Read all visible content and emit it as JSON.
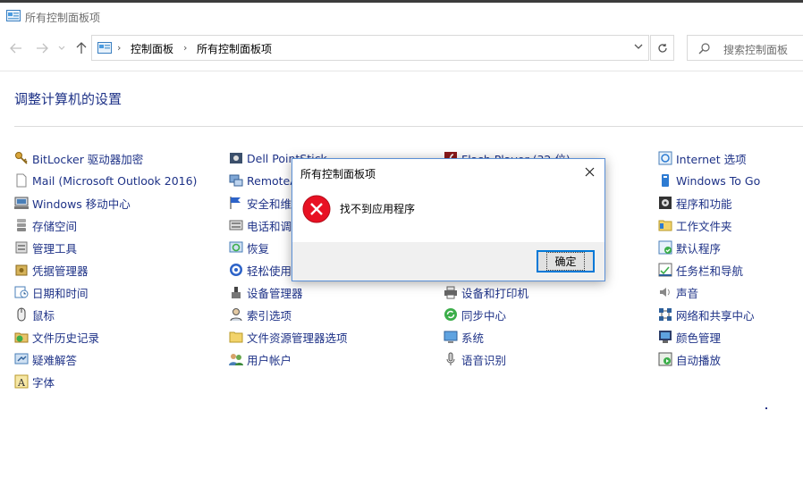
{
  "window": {
    "title": "所有控制面板项"
  },
  "nav": {
    "back_icon": "arrow-left-icon",
    "forward_icon": "arrow-right-icon",
    "recent_icon": "chevron-down-icon",
    "up_icon": "arrow-up-icon"
  },
  "address": {
    "crumbs": [
      "控制面板",
      "所有控制面板项"
    ]
  },
  "search": {
    "placeholder": "搜索控制面板"
  },
  "heading": "调整计算机的设置",
  "columns": [
    [
      {
        "label": "BitLocker 驱动器加密",
        "icon": "bitlocker-key-icon"
      },
      {
        "label": "Mail (Microsoft Outlook 2016)",
        "icon": "mail-document-icon"
      },
      {
        "label": "Windows 移动中心",
        "icon": "mobility-center-icon"
      },
      {
        "label": "存储空间",
        "icon": "storage-spaces-icon"
      },
      {
        "label": "管理工具",
        "icon": "admin-tools-icon"
      },
      {
        "label": "凭据管理器",
        "icon": "credential-manager-icon"
      },
      {
        "label": "日期和时间",
        "icon": "date-time-icon"
      },
      {
        "label": "鼠标",
        "icon": "mouse-icon"
      },
      {
        "label": "文件历史记录",
        "icon": "file-history-icon"
      },
      {
        "label": "疑难解答",
        "icon": "troubleshooting-icon"
      },
      {
        "label": "字体",
        "icon": "fonts-icon"
      }
    ],
    [
      {
        "label": "Dell PointStick",
        "icon": "pointstick-icon"
      },
      {
        "label": "RemoteA",
        "icon": "remote-app-icon"
      },
      {
        "label": "安全和维",
        "icon": "security-flag-icon"
      },
      {
        "label": "电话和调",
        "icon": "phone-modem-icon"
      },
      {
        "label": "恢复",
        "icon": "recovery-icon"
      },
      {
        "label": "轻松使用",
        "icon": "ease-of-access-icon"
      },
      {
        "label": "设备管理器",
        "icon": "device-manager-icon"
      },
      {
        "label": "索引选项",
        "icon": "indexing-icon"
      },
      {
        "label": "文件资源管理器选项",
        "icon": "folder-options-icon"
      },
      {
        "label": "用户帐户",
        "icon": "user-accounts-icon"
      }
    ],
    [
      {
        "label": "Flash Player (32 位)",
        "icon": "flash-player-icon"
      },
      {
        "label": "",
        "icon": ""
      },
      {
        "label": "",
        "icon": ""
      },
      {
        "label": "",
        "icon": ""
      },
      {
        "label": "",
        "icon": ""
      },
      {
        "label": "",
        "icon": ""
      },
      {
        "label": "设备和打印机",
        "icon": "printer-icon"
      },
      {
        "label": "同步中心",
        "icon": "sync-center-icon"
      },
      {
        "label": "系统",
        "icon": "system-icon"
      },
      {
        "label": "语音识别",
        "icon": "microphone-icon"
      }
    ],
    [
      {
        "label": "Internet 选项",
        "icon": "internet-options-icon"
      },
      {
        "label": "Windows To Go",
        "icon": "windows-to-go-icon"
      },
      {
        "label": "程序和功能",
        "icon": "programs-features-icon"
      },
      {
        "label": "工作文件夹",
        "icon": "work-folders-icon"
      },
      {
        "label": "默认程序",
        "icon": "default-programs-icon"
      },
      {
        "label": "任务栏和导航",
        "icon": "taskbar-icon"
      },
      {
        "label": "声音",
        "icon": "speaker-icon"
      },
      {
        "label": "网络和共享中心",
        "icon": "network-icon"
      },
      {
        "label": "颜色管理",
        "icon": "color-management-icon"
      },
      {
        "label": "自动播放",
        "icon": "autoplay-icon"
      }
    ]
  ],
  "dialog": {
    "title": "所有控制面板项",
    "message": "找不到应用程序",
    "ok_label": "确定"
  }
}
